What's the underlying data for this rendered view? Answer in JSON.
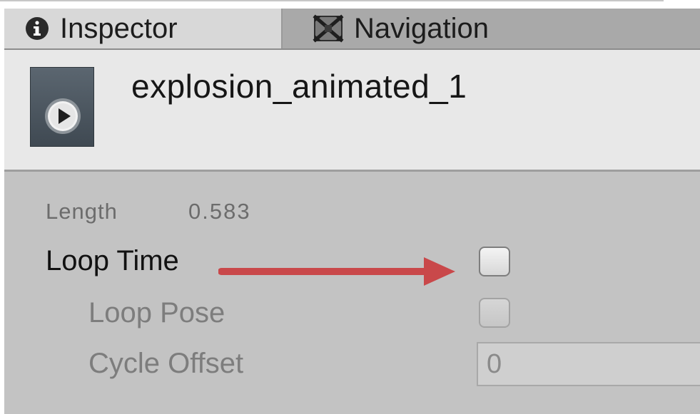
{
  "tabs": [
    {
      "label": "Inspector",
      "icon": "info-icon",
      "active": true
    },
    {
      "label": "Navigation",
      "icon": "navigation-icon",
      "active": false
    }
  ],
  "header": {
    "asset_name": "explosion_animated_1",
    "asset_icon": "animation-clip-play-icon"
  },
  "properties": {
    "length": {
      "label": "Length",
      "value": "0.583"
    },
    "loop_time": {
      "label": "Loop Time",
      "checked": false
    },
    "loop_pose": {
      "label": "Loop Pose",
      "checked": false,
      "enabled": false
    },
    "cycle_offset": {
      "label": "Cycle Offset",
      "value": "0",
      "enabled": false
    }
  },
  "annotation": {
    "type": "arrow",
    "color": "#c9484a",
    "points_to": "loop-time-checkbox"
  },
  "colors": {
    "tab_active": "#d8d8d8",
    "tab_bar": "#a9a9a9",
    "header_bg": "#e8e8e8",
    "content_bg": "#c3c3c3"
  }
}
